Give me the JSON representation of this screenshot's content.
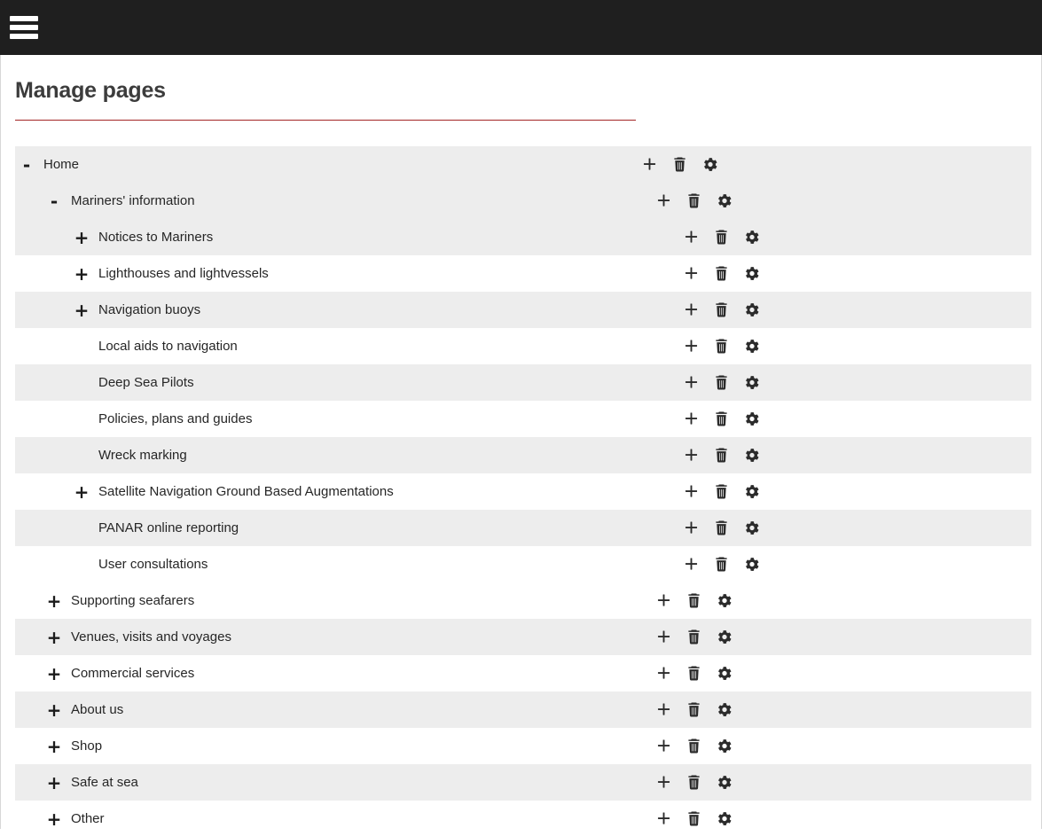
{
  "topbar": {
    "menu_icon": "hamburger-menu-icon"
  },
  "header": {
    "title": "Manage pages",
    "rule_color": "#a32525"
  },
  "colors": {
    "row_alt": "#ededed",
    "row_base": "#ffffff",
    "topbar": "#1f1f1f",
    "text": "#262626",
    "accent": "#a32525"
  },
  "row_actions": {
    "add_label": "+",
    "add_icon": "plus-icon",
    "delete_icon": "trash-icon",
    "settings_icon": "gear-icon"
  },
  "tree": {
    "rows": [
      {
        "label": "Home",
        "level": 0,
        "toggle": "-",
        "stripe": "odd"
      },
      {
        "label": "Mariners' information",
        "level": 1,
        "toggle": "-",
        "stripe": "odd"
      },
      {
        "label": "Notices to Mariners",
        "level": 2,
        "toggle": "+",
        "stripe": "odd"
      },
      {
        "label": "Lighthouses and lightvessels",
        "level": 2,
        "toggle": "+",
        "stripe": "even"
      },
      {
        "label": "Navigation buoys",
        "level": 2,
        "toggle": "+",
        "stripe": "odd"
      },
      {
        "label": "Local aids to navigation",
        "level": 2,
        "toggle": "",
        "stripe": "even"
      },
      {
        "label": "Deep Sea Pilots",
        "level": 2,
        "toggle": "",
        "stripe": "odd"
      },
      {
        "label": "Policies, plans and guides",
        "level": 2,
        "toggle": "",
        "stripe": "even"
      },
      {
        "label": "Wreck marking",
        "level": 2,
        "toggle": "",
        "stripe": "odd"
      },
      {
        "label": "Satellite Navigation Ground Based Augmentations",
        "level": 2,
        "toggle": "+",
        "stripe": "even"
      },
      {
        "label": "PANAR online reporting",
        "level": 2,
        "toggle": "",
        "stripe": "odd"
      },
      {
        "label": "User consultations",
        "level": 2,
        "toggle": "",
        "stripe": "even"
      },
      {
        "label": "Supporting seafarers",
        "level": 1,
        "toggle": "+",
        "stripe": "even"
      },
      {
        "label": "Venues, visits and voyages",
        "level": 1,
        "toggle": "+",
        "stripe": "odd"
      },
      {
        "label": "Commercial services",
        "level": 1,
        "toggle": "+",
        "stripe": "even"
      },
      {
        "label": "About us",
        "level": 1,
        "toggle": "+",
        "stripe": "odd"
      },
      {
        "label": "Shop",
        "level": 1,
        "toggle": "+",
        "stripe": "even"
      },
      {
        "label": "Safe at sea",
        "level": 1,
        "toggle": "+",
        "stripe": "odd"
      },
      {
        "label": "Other",
        "level": 1,
        "toggle": "+",
        "stripe": "even"
      }
    ]
  }
}
